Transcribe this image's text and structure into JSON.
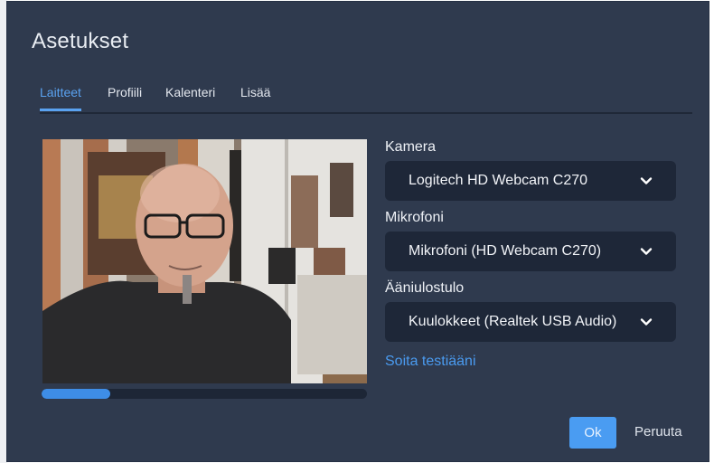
{
  "dialog": {
    "title": "Asetukset",
    "tabs": [
      {
        "label": "Laitteet",
        "active": true
      },
      {
        "label": "Profiili",
        "active": false
      },
      {
        "label": "Kalenteri",
        "active": false
      },
      {
        "label": "Lisää",
        "active": false
      }
    ]
  },
  "preview": {
    "mic_level": 0.21
  },
  "devices": {
    "camera": {
      "label": "Kamera",
      "value": "Logitech HD Webcam C270"
    },
    "microphone": {
      "label": "Mikrofoni",
      "value": "Mikrofoni (HD Webcam C270)"
    },
    "speaker": {
      "label": "Ääniulostulo",
      "value": "Kuulokkeet (Realtek USB Audio)"
    },
    "test_sound_link": "Soita testiääni"
  },
  "buttons": {
    "ok": "Ok",
    "cancel": "Peruuta"
  },
  "colors": {
    "dialog_bg": "#2f3a4e",
    "accent": "#4a9cf2",
    "select_bg": "#1e2738"
  },
  "icons": {
    "dropdown": "chevron-down-icon"
  }
}
